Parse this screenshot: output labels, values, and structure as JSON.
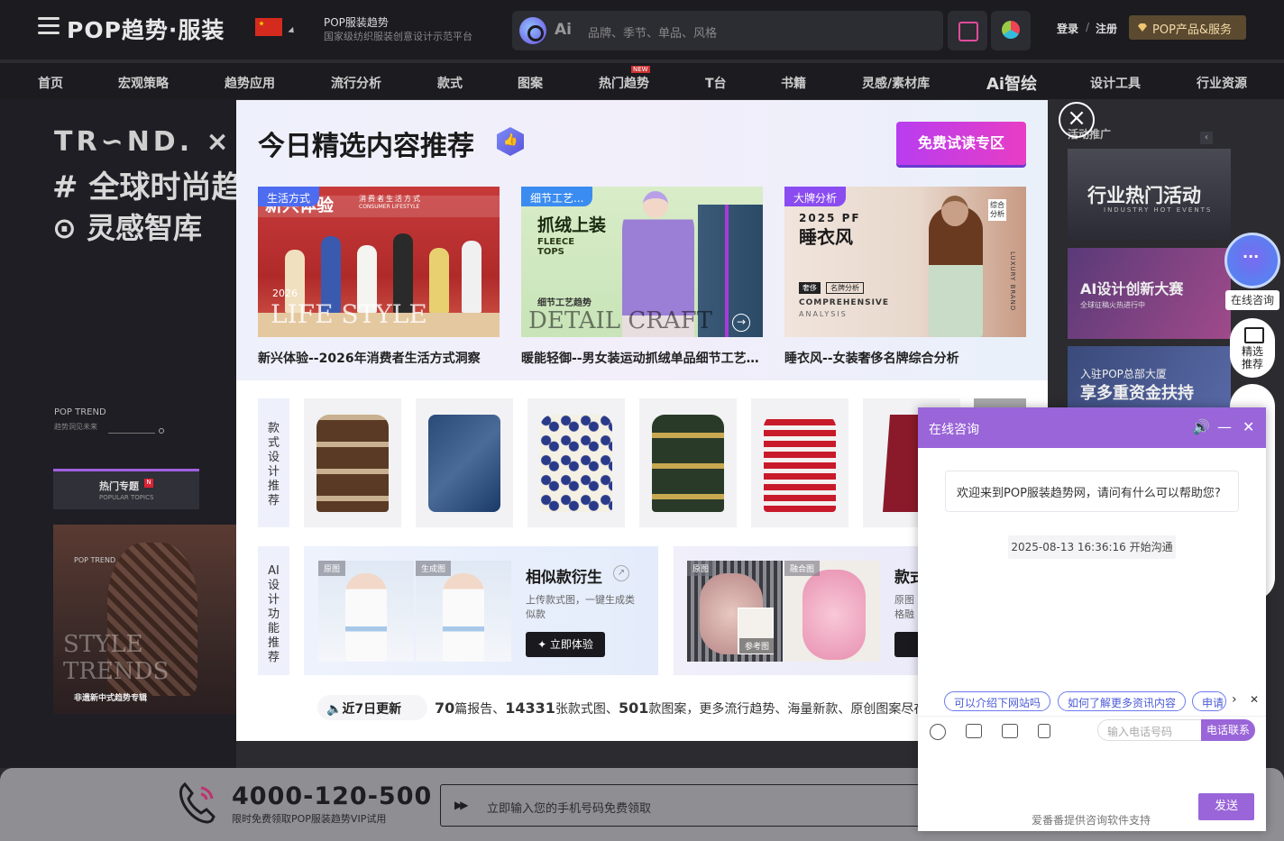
{
  "header": {
    "logo": "POP趋势·服装",
    "site_name": "POP服装趋势",
    "site_subtitle": "国家级纺织服装创意设计示范平台",
    "ai_label": "Ai",
    "search_placeholder": "品牌、季节、单品、风格",
    "login": "登录",
    "slash": "/",
    "register": "注册",
    "products_button": "POP产品&服务"
  },
  "nav": {
    "items": [
      "首页",
      "宏观策略",
      "趋势应用",
      "流行分析",
      "款式",
      "图案",
      "热门趋势",
      "T台",
      "书籍",
      "灵感/素材库",
      "Ai智绘",
      "设计工具",
      "行业资源"
    ],
    "new_tag": "NEW"
  },
  "background": {
    "trend_logo": "TR∽ND. ×",
    "hash_line": "# 全球时尚趋",
    "inspire_line": "⊙ 灵感智库",
    "pop_trend": "POP TREND",
    "pop_trend_sub": "趋势洞见未来",
    "hot_topics": "热门专题",
    "hot_topics_sub": "POPULAR TOPICS",
    "hot_badge": "N",
    "left_card_brand": "POP TREND",
    "left_card_style": "STYLE\nTRENDS",
    "left_card_label": "非遗新中式趋势专辑",
    "right_title": "活动推广",
    "right_cards": [
      {
        "title": "行业热门活动",
        "sub": "INDUSTRY HOT EVENTS"
      },
      {
        "title": "AI设计创新大赛",
        "sub": "全球征稿火热进行中"
      },
      {
        "title": "享多重资金扶持",
        "sub": "入驻POP总部大厦"
      }
    ]
  },
  "modal": {
    "title": "今日精选内容推荐",
    "trial_button": "免费试读专区",
    "cards": [
      {
        "tag": "生活方式",
        "caption": "新兴体验--2026年消费者生活方式洞察",
        "art_title": "新兴体验",
        "art_sub": "消费者生活方式",
        "art_sub2": "CONSUMER LIFESTYLE",
        "art_year": "2026",
        "art_big": "LIFE STYLE"
      },
      {
        "tag": "细节工艺...",
        "caption": "暖能轻御--男女装运动抓绒单品细节工艺…",
        "art_title": "抓绒上装",
        "art_sub": "FLEECE\nTOPS",
        "art_text1": "细节工艺趋势",
        "art_text2": "DETAIL CRAFT"
      },
      {
        "tag": "大牌分析",
        "caption": "睡衣风--女装奢侈名牌综合分析",
        "art_year": "2025 PF",
        "art_title": "睡衣风",
        "art_chip": "奢侈",
        "art_chip2": "名牌分析",
        "art_comp": "COMPREHENSIVE",
        "art_ana": "ANALYSIS",
        "art_badge": "综合\n分析",
        "art_luxury": "LUXURY BRAND"
      }
    ],
    "style_section_label": "款式设计推荐",
    "ai_section_label": "AI设计功能推荐",
    "ai_panels": [
      {
        "tag_a": "原图",
        "tag_b": "生成图",
        "title": "相似款衍生",
        "desc": "上传款式图，一键生成类似款",
        "button": "✦ 立即体验"
      },
      {
        "tag_a": "原图",
        "tag_b": "融合图",
        "tag_c": "参考图",
        "title": "款式",
        "desc": "原图\n格融",
        "button": "✦"
      }
    ],
    "updates_label": "近7日更新",
    "updates": {
      "reports": "70",
      "reports_unit": "篇报告、",
      "styles": "14331",
      "styles_unit": "张款式图、",
      "patterns": "501",
      "patterns_unit": "款图案，更多流行趋势、海量新款、原创图案尽在POP"
    }
  },
  "float": {
    "consult_label": "在线咨询",
    "rec_label": "精选\n推荐"
  },
  "chat": {
    "title": "在线咨询",
    "welcome": "欢迎来到POP服装趋势网，请问有什么可以帮助您?",
    "start_time": "2025-08-13 16:36:16 开始沟通",
    "quick": [
      "可以介绍下网站吗",
      "如何了解更多资讯内容",
      "申请"
    ],
    "phone_placeholder": "输入电话号码",
    "phone_button": "电话联系",
    "send_button": "发送",
    "footer": "爱番番提供咨询软件支持"
  },
  "bottom": {
    "phone": "4000-120-500",
    "phone_sub": "限时免费领取POP服装趋势VIP试用",
    "input_placeholder": "立即输入您的手机号码免费领取"
  },
  "colors": {
    "accent": "#9a65d8",
    "trial": "#d23dd8"
  },
  "icons": [
    "menu-icon",
    "search-icon",
    "close-icon",
    "thumb-up-icon",
    "phone-icon",
    "speaker-icon",
    "emoji-icon",
    "image-icon",
    "folder-icon",
    "vibrate-icon",
    "chat-bubble-icon",
    "book-icon"
  ]
}
